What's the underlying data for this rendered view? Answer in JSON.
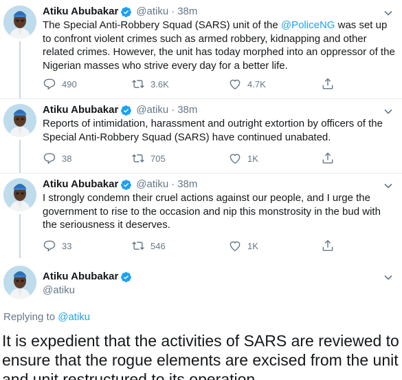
{
  "tweets": [
    {
      "name": "Atiku Abubakar",
      "handle": "@atiku",
      "separator": "·",
      "time": "38m",
      "text_before": "The Special Anti-Robbery Squad (SARS) unit of the ",
      "mention": "@PoliceNG",
      "text_after": " was set up to confront violent crimes such as armed robbery, kidnapping and other related crimes. However, the unit has today morphed into an oppressor of the Nigerian masses who strive every day for a better life.",
      "replies": "490",
      "retweets": "3.6K",
      "likes": "4.7K"
    },
    {
      "name": "Atiku Abubakar",
      "handle": "@atiku",
      "separator": "·",
      "time": "38m",
      "text": "Reports of intimidation, harassment and outright extortion by officers of the Special Anti-Robbery Squad (SARS) have continued unabated.",
      "replies": "38",
      "retweets": "705",
      "likes": "1K"
    },
    {
      "name": "Atiku Abubakar",
      "handle": "@atiku",
      "separator": "·",
      "time": "38m",
      "text": "I strongly condemn their cruel actions against our people, and I urge the government to rise to the occasion and nip this monstrosity in the bud with the seriousness it deserves.",
      "replies": "33",
      "retweets": "546",
      "likes": "1K"
    }
  ],
  "focal": {
    "name": "Atiku Abubakar",
    "handle": "@atiku",
    "replying_label": "Replying to ",
    "replying_handle": "@atiku",
    "text": "It is expedient that the activities of SARS are reviewed to ensure that the rogue elements are excised from the unit and unit restructured to its operation"
  },
  "colors": {
    "accent": "#1da1f2",
    "muted": "#657786",
    "text": "#14171a",
    "divider": "#e6ecf0"
  },
  "icons": [
    "verified-badge-icon",
    "chevron-down-icon",
    "reply-icon",
    "retweet-icon",
    "like-icon",
    "share-icon"
  ]
}
